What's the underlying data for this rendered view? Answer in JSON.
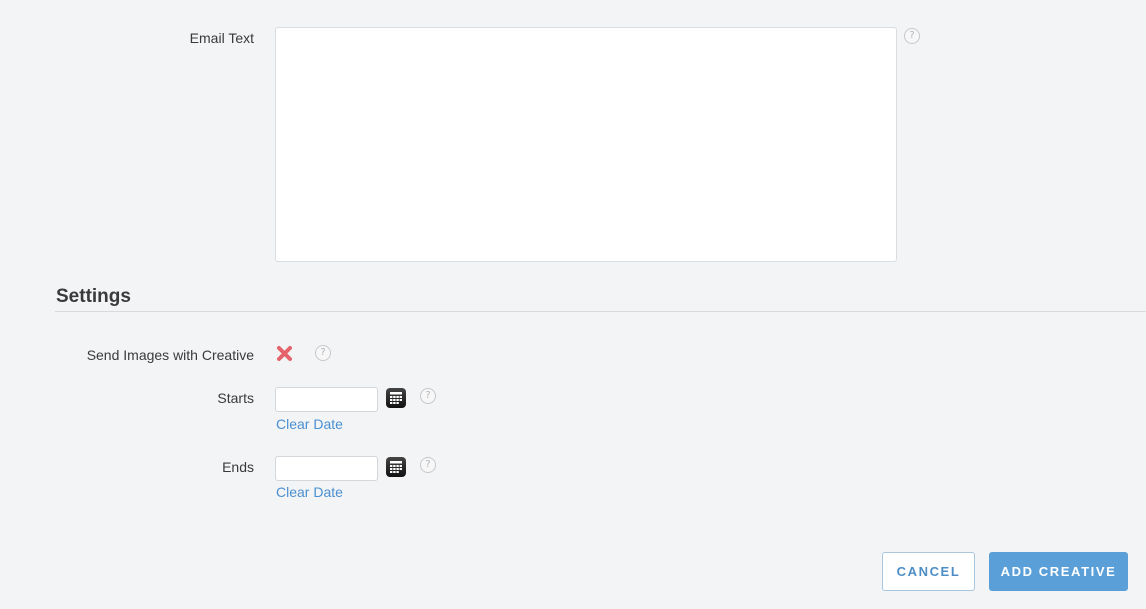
{
  "email_text": {
    "label": "Email Text",
    "value": "",
    "help_glyph": "?"
  },
  "settings": {
    "title": "Settings",
    "send_images": {
      "label": "Send Images with Creative",
      "state_icon": "x-icon",
      "enabled": false,
      "help_glyph": "?"
    },
    "starts": {
      "label": "Starts",
      "value": "",
      "clear_label": "Clear Date",
      "help_glyph": "?"
    },
    "ends": {
      "label": "Ends",
      "value": "",
      "clear_label": "Clear Date",
      "help_glyph": "?"
    }
  },
  "actions": {
    "cancel_label": "Cancel",
    "add_label": "Add Creative"
  },
  "colors": {
    "background": "#f3f4f6",
    "link": "#4a8fcf",
    "primary_button": "#5b9fd8",
    "disabled_x": "#e5636b"
  }
}
